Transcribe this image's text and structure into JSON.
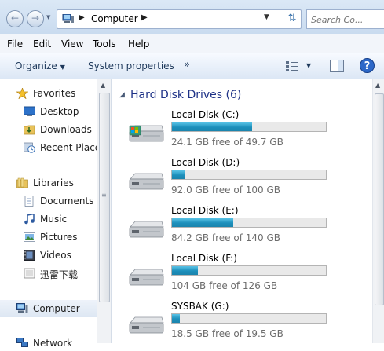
{
  "address_bar": {
    "breadcrumb": "Computer",
    "search_placeholder": "Search Co..."
  },
  "menu": [
    "File",
    "Edit",
    "View",
    "Tools",
    "Help"
  ],
  "command_bar": {
    "organize": "Organize",
    "system_properties": "System properties",
    "more": "»"
  },
  "nav_pane": {
    "favorites": {
      "label": "Favorites",
      "items": [
        "Desktop",
        "Downloads",
        "Recent Place"
      ]
    },
    "libraries": {
      "label": "Libraries",
      "items": [
        "Documents",
        "Music",
        "Pictures",
        "Videos",
        "迅雷下载"
      ]
    },
    "computer": "Computer",
    "network": "Network"
  },
  "content": {
    "group_title": "Hard Disk Drives (6)",
    "drives": [
      {
        "name": "Local Disk (C:)",
        "free_text": "24.1 GB free of 49.7 GB",
        "used_fraction": 0.52
      },
      {
        "name": "Local Disk (D:)",
        "free_text": "92.0 GB free of 100 GB",
        "used_fraction": 0.08
      },
      {
        "name": "Local Disk (E:)",
        "free_text": "84.2 GB free of 140 GB",
        "used_fraction": 0.4
      },
      {
        "name": "Local Disk (F:)",
        "free_text": "104 GB free of 126 GB",
        "used_fraction": 0.17
      },
      {
        "name": "SYSBAK (G:)",
        "free_text": "18.5 GB free of 19.5 GB",
        "used_fraction": 0.05
      }
    ]
  },
  "colors": {
    "accent": "#1e3287",
    "bar_fill": "#1d8fbb",
    "selected_nav": "#dde7f3"
  }
}
